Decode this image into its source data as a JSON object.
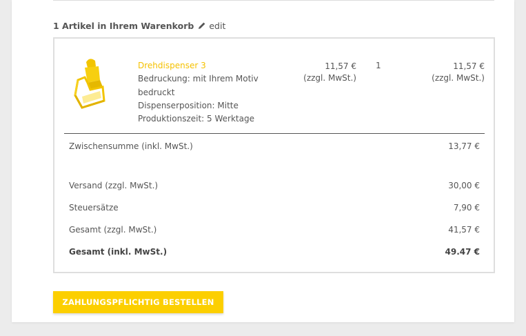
{
  "cart": {
    "count_label": "1 Artikel in Ihrem Warenkorb",
    "edit_label": "edit"
  },
  "item": {
    "name": "Drehdispenser 3",
    "options": [
      "Bedruckung: mit Ihrem Motiv bedruckt",
      "Dispenserposition: Mitte",
      "Produktionszeit: 5 Werktage"
    ],
    "price": "11,57 €",
    "price_note": "(zzgl. MwSt.)",
    "qty": "1",
    "total": "11,57 €",
    "total_note": "(zzgl. MwSt.)",
    "image_icon": "product-dispenser-image"
  },
  "summary": {
    "subtotal_label": "Zwischensumme (inkl. MwSt.)",
    "subtotal_value": "13,77 €",
    "shipping_label": "Versand (zzgl. MwSt.)",
    "shipping_value": "30,00 €",
    "tax_label": "Steuersätze",
    "tax_value": "7,90 €",
    "total_excl_label": "Gesamt (zzgl. MwSt.)",
    "total_excl_value": "41,57 €",
    "total_incl_label": "Gesamt (inkl. MwSt.)",
    "total_incl_value": "49.47 €"
  },
  "actions": {
    "order_button": "ZAHLUNGSPFLICHTIG BESTELLEN"
  },
  "colors": {
    "accent": "#fccf00",
    "product_link": "#f5c100",
    "text": "#555555"
  }
}
